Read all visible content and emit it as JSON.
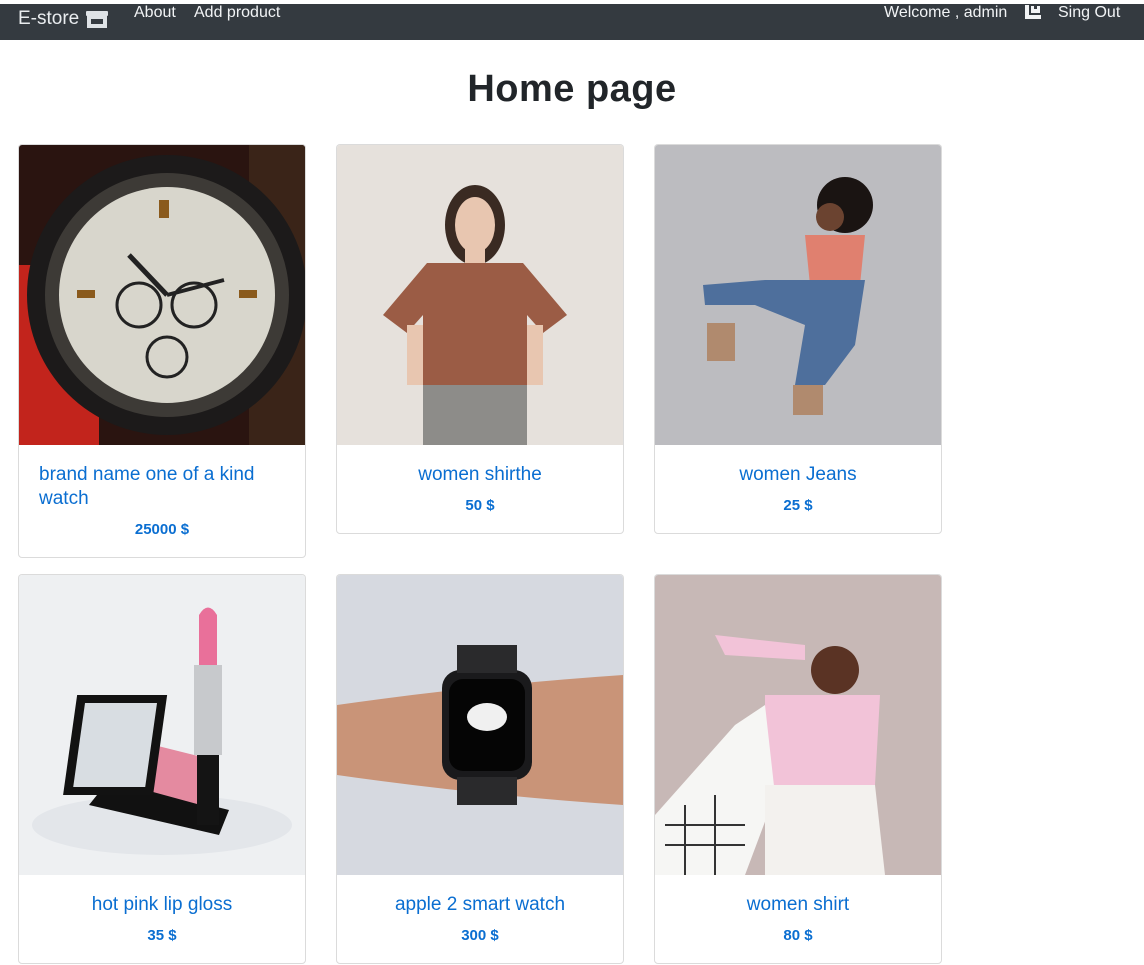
{
  "navbar": {
    "brand": "E-store",
    "brand_icon": "store-icon",
    "links": [
      "About",
      "Add product"
    ],
    "welcome": "Welcome , admin",
    "cart_icon": "cart-icon",
    "signout": "Sing Out",
    "bg_color": "#343a40"
  },
  "page": {
    "title": "Home page"
  },
  "products": [
    {
      "name": "brand name one of a kind watch",
      "price": "25000 $",
      "image": "wristwatch-photo"
    },
    {
      "name": "women shirthe",
      "price": "50 $",
      "image": "brown-tshirt-photo"
    },
    {
      "name": "women Jeans",
      "price": "25 $",
      "image": "jeans-model-photo"
    },
    {
      "name": "hot pink lip gloss",
      "price": "35 $",
      "image": "lipstick-photo"
    },
    {
      "name": "apple 2 smart watch",
      "price": "300 $",
      "image": "smartwatch-photo"
    },
    {
      "name": "women shirt",
      "price": "80 $",
      "image": "pink-shirt-model-photo"
    }
  ],
  "accent_color": "#0a6ed1"
}
